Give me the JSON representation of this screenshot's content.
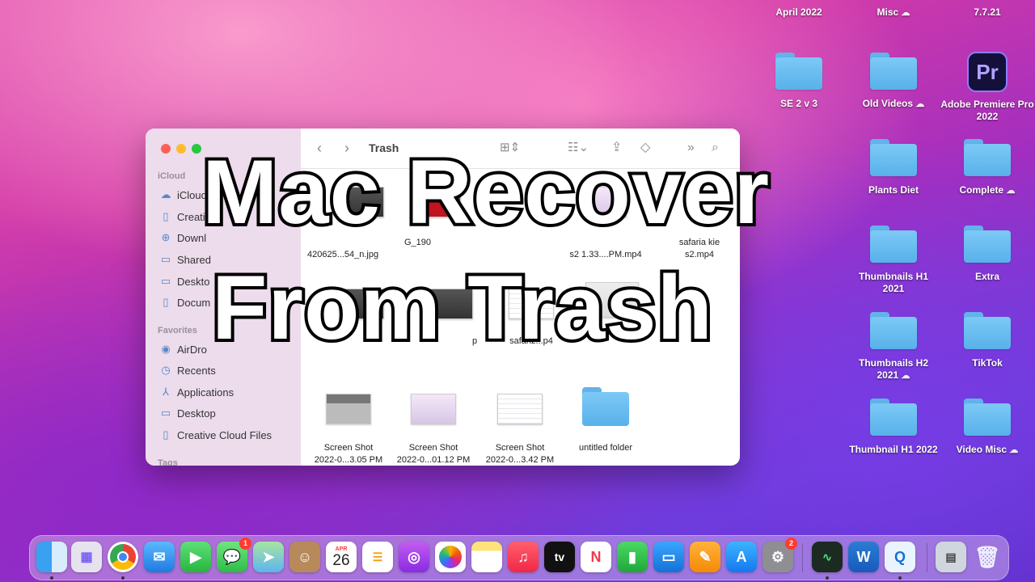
{
  "desktop": {
    "items": [
      {
        "label": "April 2022",
        "cloud": ""
      },
      {
        "label": "Misc",
        "cloud": "☁"
      },
      {
        "label": "7.7.21",
        "cloud": ""
      },
      {
        "label": "SE 2 v 3",
        "cloud": ""
      },
      {
        "label": "Old Videos",
        "cloud": "☁"
      },
      {
        "label": "Adobe Premiere Pro 2022",
        "cloud": ""
      },
      {
        "label": "Plants Diet",
        "cloud": ""
      },
      {
        "label": "Complete",
        "cloud": "☁"
      },
      {
        "label": "Thumbnails H1 2021",
        "cloud": ""
      },
      {
        "label": "Extra",
        "cloud": ""
      },
      {
        "label": "Thumbnails H2 2021",
        "cloud": "☁"
      },
      {
        "label": "TikTok",
        "cloud": ""
      },
      {
        "label": "Thumbnail H1 2022",
        "cloud": ""
      },
      {
        "label": "Video Misc",
        "cloud": "☁"
      }
    ],
    "premiere_icon": "Pr"
  },
  "finder": {
    "title": "Trash",
    "sidebar": {
      "icloud_heading": "iCloud",
      "favorites_heading": "Favorites",
      "tags_heading": "Tags",
      "icloud_items": [
        "iCloud",
        "Creativ",
        "Downl",
        "Shared",
        "Deskto",
        "Docum"
      ],
      "favorite_items": [
        "AirDro",
        "Recents",
        "Applications",
        "Desktop",
        "Creative Cloud Files"
      ]
    },
    "files_row1": [
      {
        "name": "420625...54_n.jpg",
        "extra": "G_190"
      },
      {
        "name": "s2 1.33....PM.mp4",
        "extra": ""
      },
      {
        "name": "s2.mp4",
        "extra": "safaria kie"
      }
    ],
    "files_row2": [
      {
        "name": "p"
      },
      {
        "name": "safariz...p4"
      }
    ],
    "files_row3": [
      {
        "name": "Screen Shot",
        "sub": "2022-0...3.05 PM"
      },
      {
        "name": "Screen Shot",
        "sub": "2022-0...01.12 PM"
      },
      {
        "name": "Screen Shot",
        "sub": "2022-0...3.42 PM"
      },
      {
        "name": "untitled folder",
        "sub": ""
      }
    ]
  },
  "overlay": {
    "line1": "Mac Recover",
    "line2": "From Trash"
  },
  "dock": {
    "calendar_month": "APR",
    "calendar_day": "26",
    "messages_badge": "1",
    "settings_badge": "2",
    "tv_label": "tv"
  }
}
